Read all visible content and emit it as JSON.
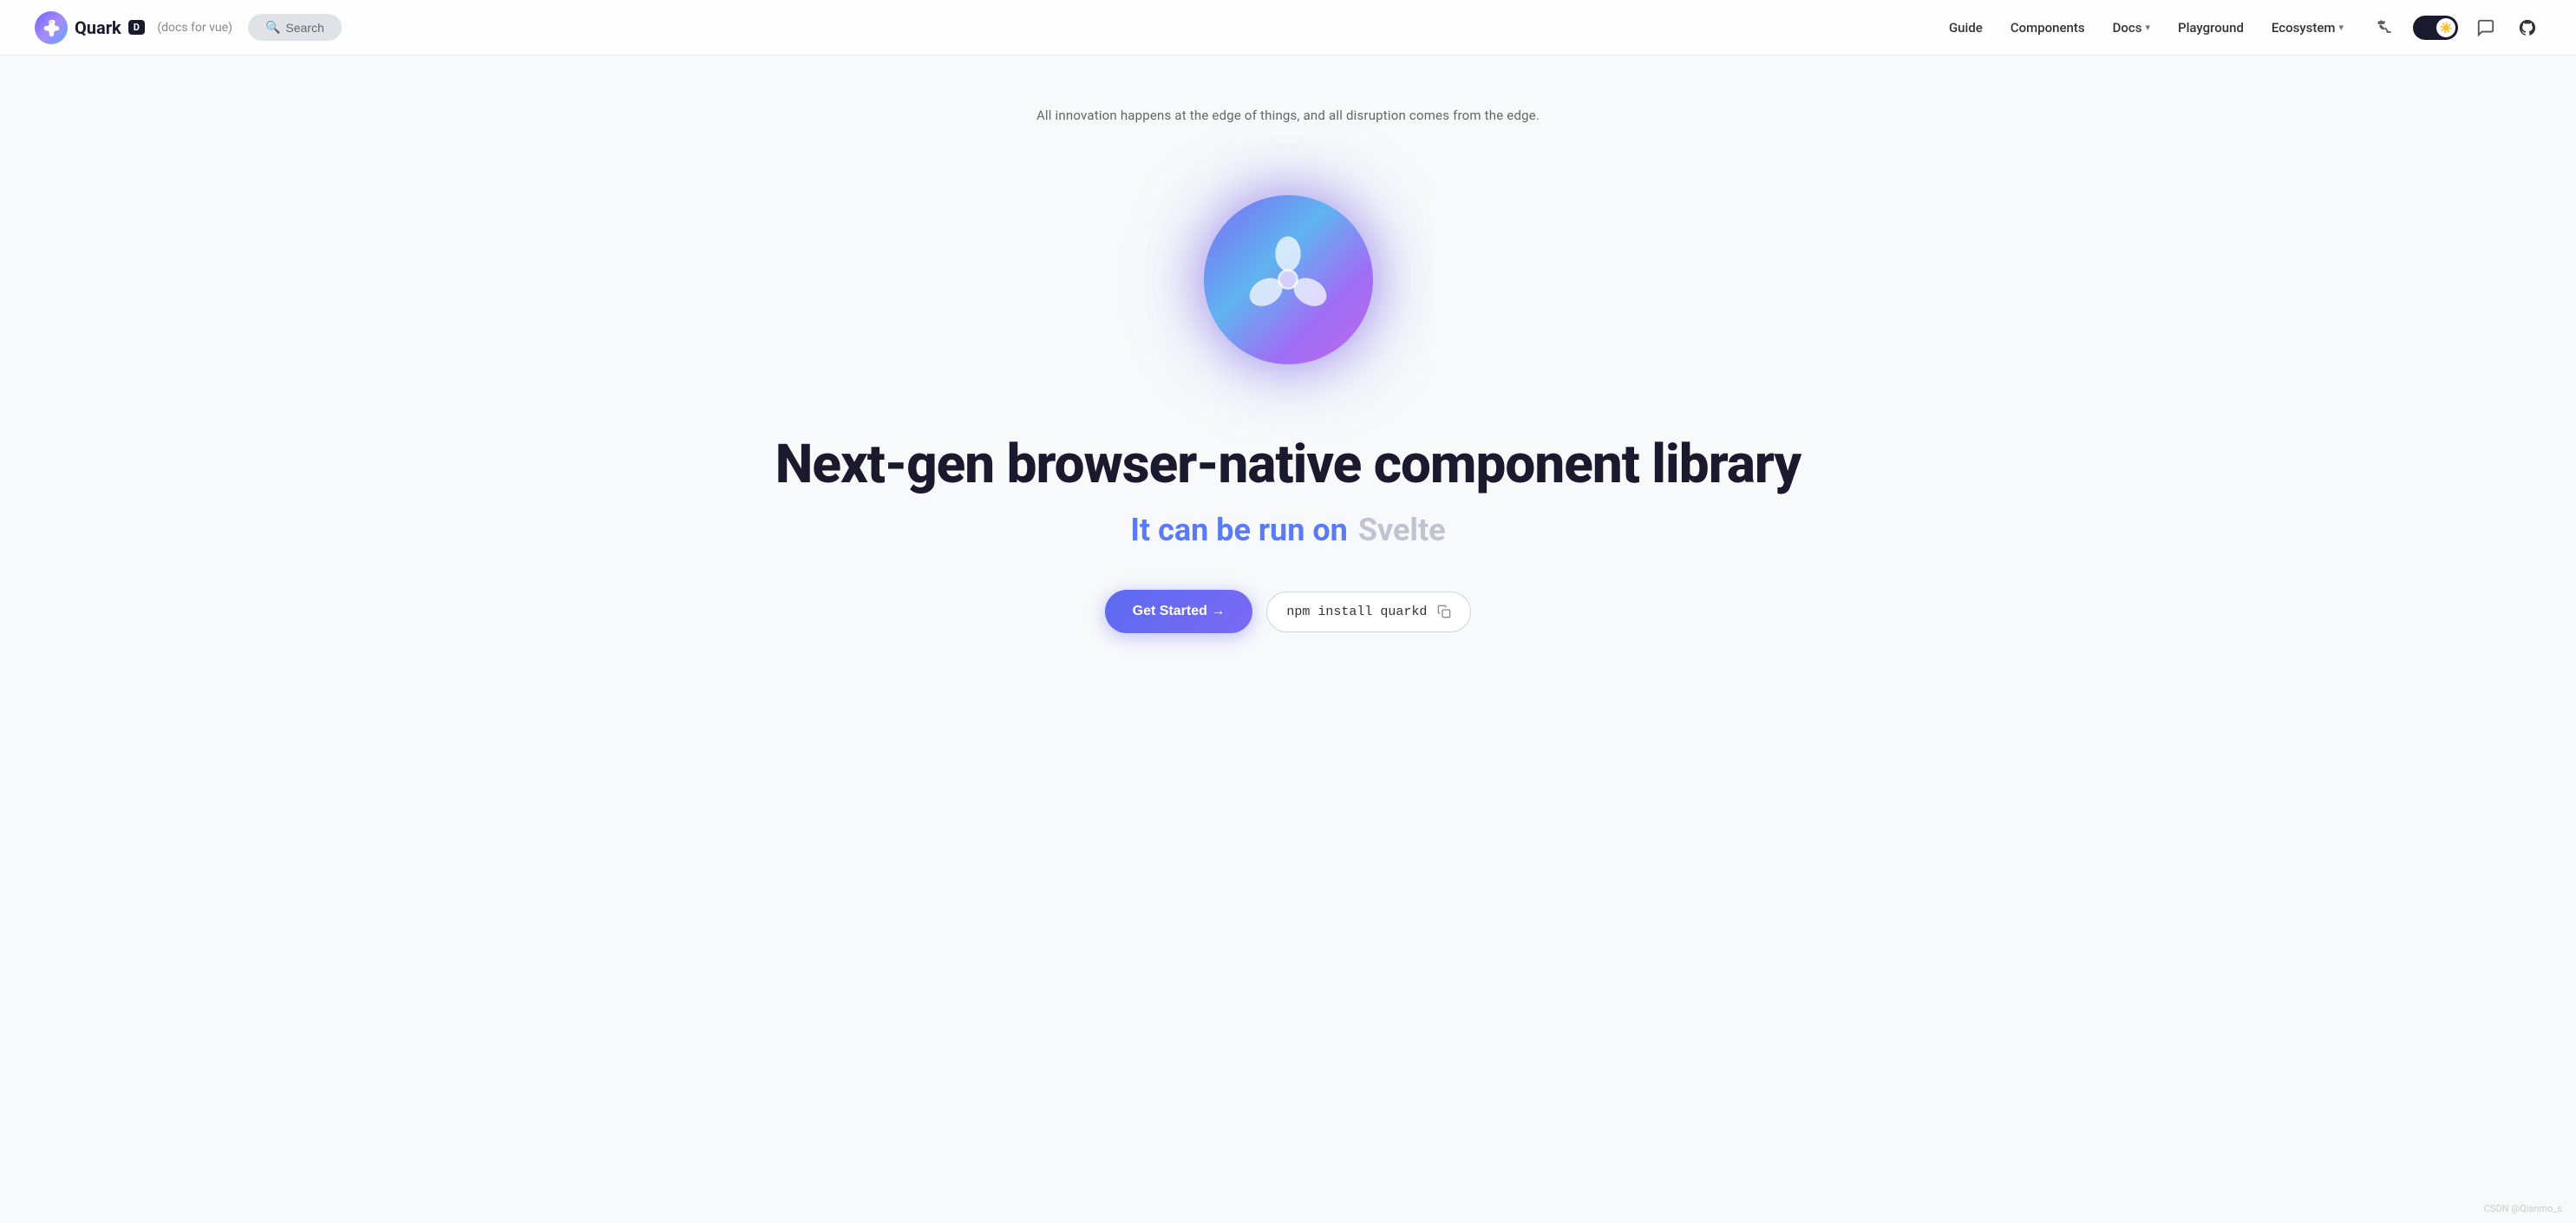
{
  "brand": {
    "logo_alt": "Quark logo",
    "name": "Quark",
    "badge": "D",
    "docs_label": "(docs for vue)"
  },
  "search": {
    "placeholder": "Search...",
    "label": "Search"
  },
  "nav": {
    "links": [
      {
        "label": "Guide",
        "href": "#",
        "has_dropdown": false
      },
      {
        "label": "Components",
        "href": "#",
        "has_dropdown": false
      },
      {
        "label": "Docs",
        "href": "#",
        "has_dropdown": true
      },
      {
        "label": "Playground",
        "href": "#",
        "has_dropdown": false
      },
      {
        "label": "Ecosystem",
        "href": "#",
        "has_dropdown": true
      }
    ],
    "theme_toggle_state": "dark",
    "theme_icon": "☀️",
    "translate_icon": "🌐",
    "chat_icon": "💬",
    "github_icon": "⭕"
  },
  "hero": {
    "tagline": "All innovation happens at the edge of things, and all disruption comes from the edge.",
    "headline": "Next-gen browser-native component library",
    "sub_prefix": "It can be run on",
    "sub_framework": "Svelte",
    "cta_button": "Get Started →",
    "npm_command": "npm install quarkd",
    "copy_tooltip": "Copy"
  },
  "footer": {
    "watermark": "CSDN @Qianmo_s"
  }
}
